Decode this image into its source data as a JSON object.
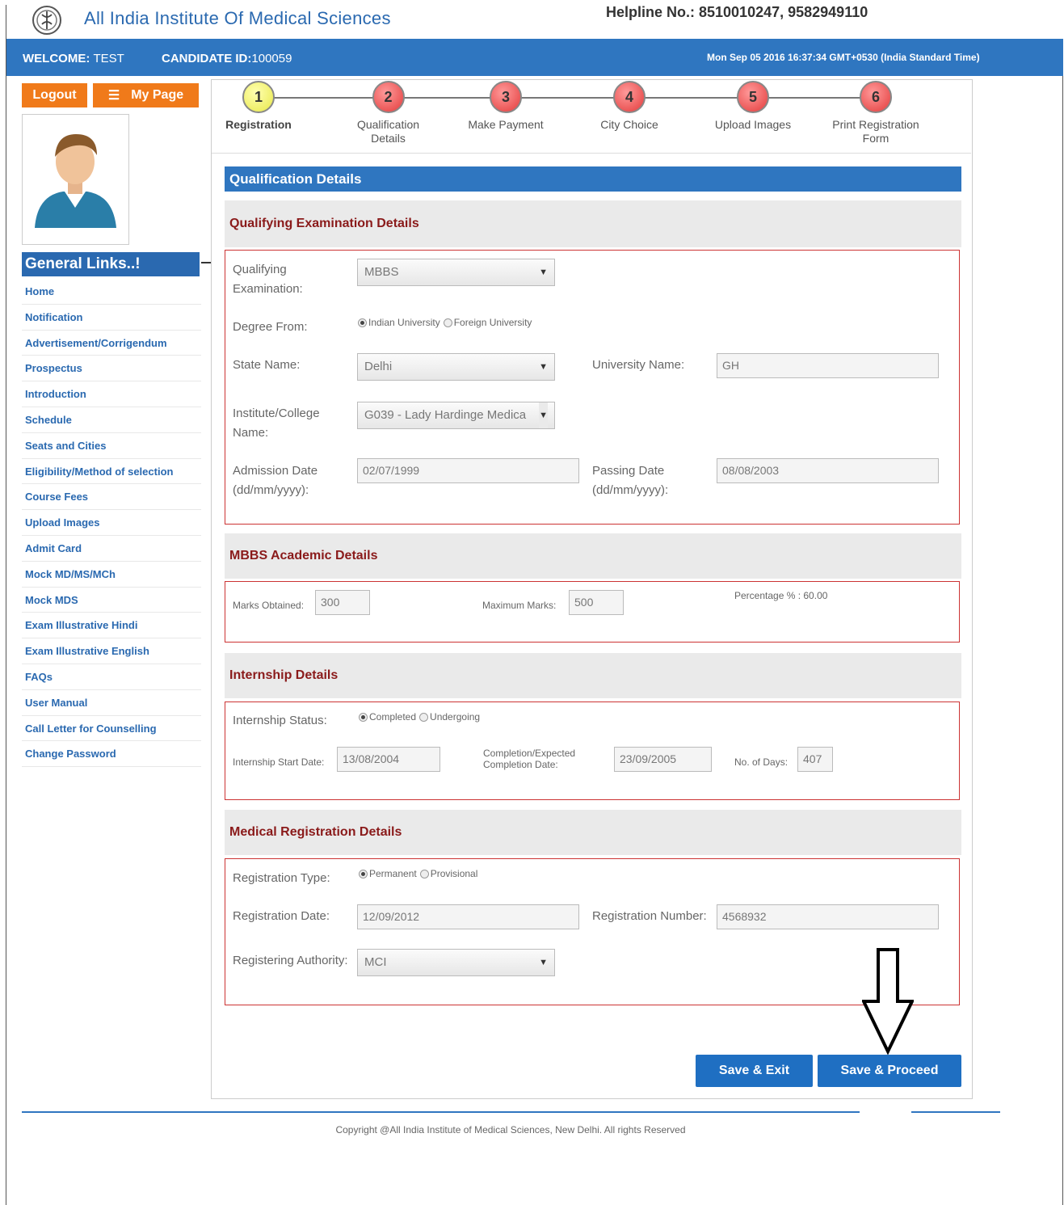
{
  "header": {
    "site_title": "All India Institute Of Medical Sciences",
    "helpline": "Helpline No.: 8510010247, 9582949110",
    "welcome_label": "WELCOME:",
    "welcome_name": "TEST",
    "candidate_label": "CANDIDATE ID:",
    "candidate_id": "100059",
    "datetime": "Mon Sep 05 2016 16:37:34 GMT+0530 (India Standard Time)"
  },
  "sidebar": {
    "logout_label": "Logout",
    "mypage_label": "My Page",
    "links_header": "General Links..!",
    "links": [
      "Home",
      "Notification",
      "Advertisement/Corrigendum",
      "Prospectus",
      "Introduction",
      "Schedule",
      "Seats and Cities",
      "Eligibility/Method of selection",
      "Course Fees",
      "Upload Images",
      "Admit Card",
      "Mock MD/MS/MCh",
      "Mock MDS",
      "Exam Illustrative Hindi",
      "Exam Illustrative English",
      "FAQs",
      "User Manual",
      "Call Letter for Counselling",
      "Change Password"
    ]
  },
  "steps": [
    {
      "num": "1",
      "label": "Registration"
    },
    {
      "num": "2",
      "label": "Qualification Details"
    },
    {
      "num": "3",
      "label": "Make Payment"
    },
    {
      "num": "4",
      "label": "City Choice"
    },
    {
      "num": "5",
      "label": "Upload Images"
    },
    {
      "num": "6",
      "label": "Print Registration Form"
    }
  ],
  "form": {
    "section_title": "Qualification Details",
    "qualifying": {
      "heading": "Qualifying Examination Details",
      "exam_label": "Qualifying Examination:",
      "exam_value": "MBBS",
      "degree_label": "Degree From:",
      "degree_options": [
        "Indian University",
        "Foreign University"
      ],
      "degree_selected": "Indian University",
      "state_label": "State Name:",
      "state_value": "Delhi",
      "university_label": "University Name:",
      "university_value": "GH",
      "institute_label": "Institute/College Name:",
      "institute_value": "G039 - Lady Hardinge Medica",
      "admission_label": "Admission Date (dd/mm/yyyy):",
      "admission_value": "02/07/1999",
      "passing_label": "Passing Date (dd/mm/yyyy):",
      "passing_value": "08/08/2003"
    },
    "academic": {
      "heading": "MBBS Academic Details",
      "marks_label": "Marks Obtained:",
      "marks_value": "300",
      "max_label": "Maximum Marks:",
      "max_value": "500",
      "percentage_text": "Percentage % : 60.00"
    },
    "internship": {
      "heading": "Internship Details",
      "status_label": "Internship Status:",
      "status_options": [
        "Completed",
        "Undergoing"
      ],
      "status_selected": "Completed",
      "start_label": "Internship Start Date:",
      "start_value": "13/08/2004",
      "completion_label": "Completion/Expected Completion Date:",
      "completion_value": "23/09/2005",
      "days_label": "No. of Days:",
      "days_value": "407"
    },
    "registration": {
      "heading": "Medical Registration Details",
      "type_label": "Registration Type:",
      "type_options": [
        "Permanent",
        "Provisional"
      ],
      "type_selected": "Permanent",
      "date_label": "Registration Date:",
      "date_value": "12/09/2012",
      "number_label": "Registration Number:",
      "number_value": "4568932",
      "authority_label": "Registering Authority:",
      "authority_value": "MCI"
    },
    "buttons": {
      "save_exit": "Save & Exit",
      "save_proceed": "Save & Proceed"
    }
  },
  "footer": {
    "copyright": "Copyright @All India Institute of Medical Sciences, New Delhi. All rights Reserved"
  },
  "colors": {
    "primary_blue": "#2f76c0",
    "orange": "#f07a1a",
    "section_red": "#8a1a1a",
    "active_step": "#e8e84a",
    "pending_step": "#e33b3b"
  }
}
